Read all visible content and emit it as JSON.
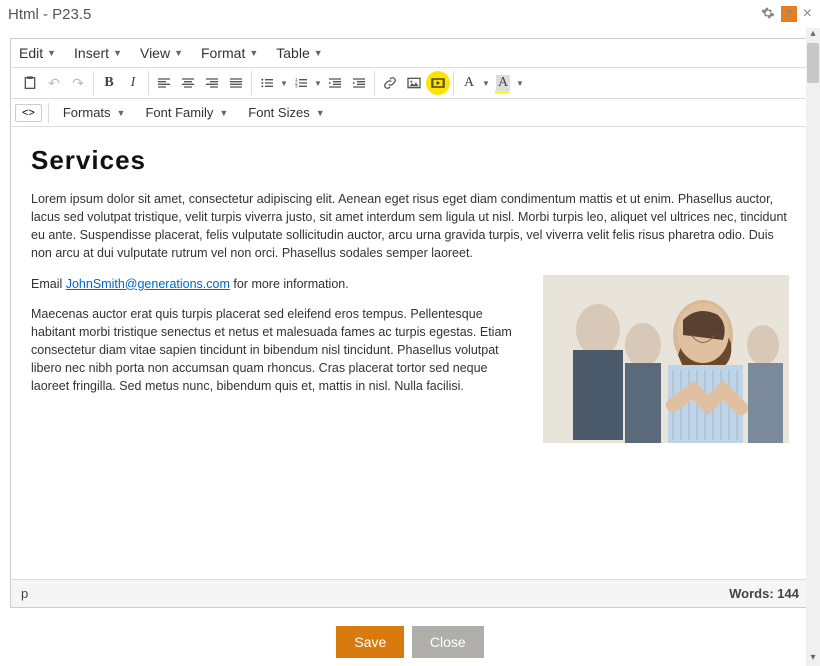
{
  "window": {
    "title": "Html - P23.5",
    "help_badge": "?"
  },
  "menu": {
    "edit": "Edit",
    "insert": "Insert",
    "view": "View",
    "format": "Format",
    "table": "Table"
  },
  "toolbar2": {
    "formats": "Formats",
    "font_family": "Font Family",
    "font_sizes": "Font Sizes"
  },
  "content": {
    "heading": "Services",
    "p1": "Lorem ipsum dolor sit amet, consectetur adipiscing elit. Aenean eget risus eget diam condimentum mattis et ut enim. Phasellus auctor, lacus sed volutpat tristique, velit turpis viverra justo, sit amet interdum sem ligula ut nisl. Morbi turpis leo, aliquet vel ultrices nec, tincidunt eu ante. Suspendisse placerat, felis vulputate sollicitudin auctor, arcu urna gravida turpis, vel viverra velit felis risus pharetra odio. Duis non arcu at dui vulputate rutrum vel non orci. Phasellus sodales semper laoreet.",
    "p2_a": "Email ",
    "p2_link": "JohnSmith@generations.com",
    "p2_b": " for more information.",
    "p3": "Maecenas auctor erat quis turpis placerat sed eleifend eros tempus. Pellentesque habitant morbi tristique senectus et netus et malesuada fames ac turpis egestas. Etiam consectetur diam vitae sapien tincidunt in bibendum nisl tincidunt. Phasellus volutpat libero nec nibh porta non accumsan quam rhoncus. Cras placerat tortor sed neque laoreet fringilla. Sed metus nunc, bibendum quis et, mattis in nisl. Nulla facilisi."
  },
  "status": {
    "path": "p",
    "words_label": "Words: ",
    "words_count": "144"
  },
  "buttons": {
    "save": "Save",
    "close": "Close"
  },
  "colors": {
    "accent": "#d87a0d",
    "text_color_swatch": "#cc0000",
    "bg_color_swatch": "#ffff00"
  }
}
